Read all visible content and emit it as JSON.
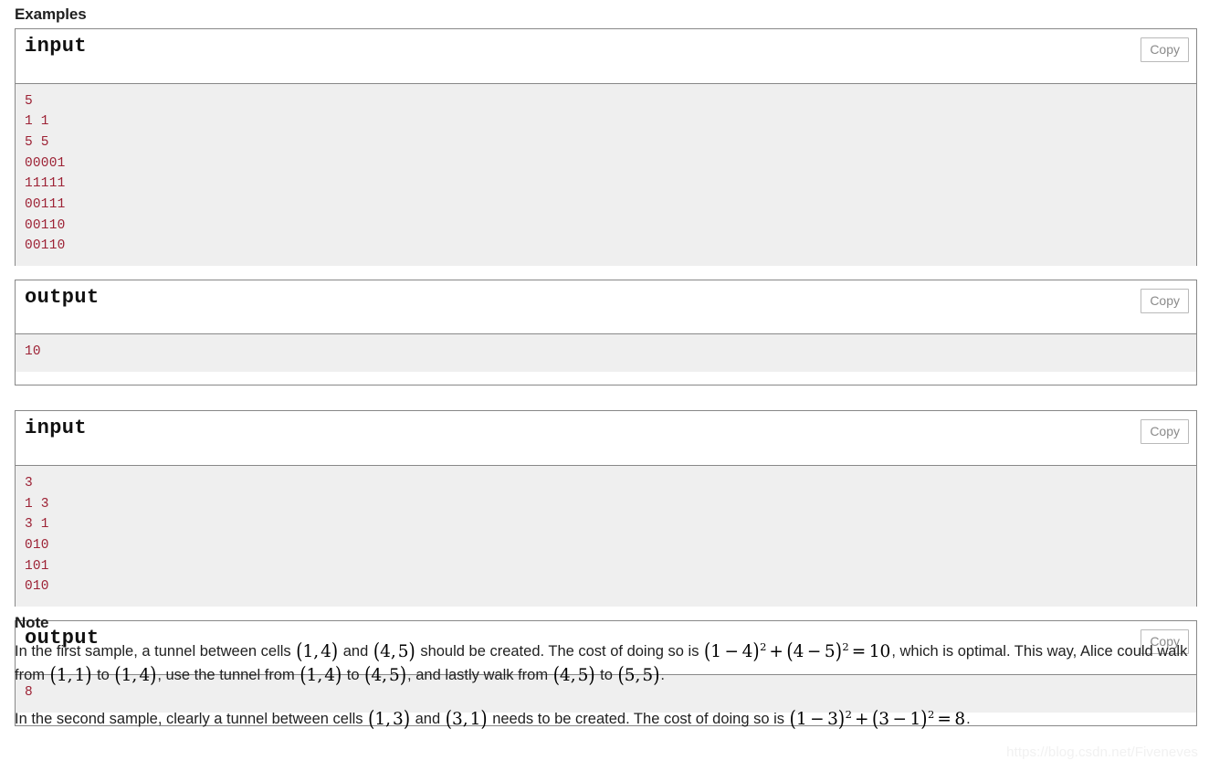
{
  "sections": {
    "examples_title": "Examples",
    "note_title": "Note"
  },
  "copy_label": "Copy",
  "samples": [
    {
      "input": {
        "title": "input",
        "text": "5\n1 1\n5 5\n00001\n11111\n00111\n00110\n00110"
      },
      "output": {
        "title": "output",
        "text": "10"
      }
    },
    {
      "input": {
        "title": "input",
        "text": "3\n1 3\n3 1\n010\n101\n010"
      },
      "output": {
        "title": "output",
        "text": "8"
      }
    }
  ],
  "note": {
    "paragraph1": {
      "t1": "In the first sample, a tunnel between cells ",
      "m1": "(1, 4)",
      "t2": " and ",
      "m2": "(4, 5)",
      "t3": " should be created. The cost of doing so is ",
      "m3": "(1 − 4)² + (4 − 5)² = 10",
      "t4": ", which is optimal. This way, Alice could walk from ",
      "m4": "(1, 1)",
      "t5": " to ",
      "m5": "(1, 4)",
      "t6": ", use the tunnel from ",
      "m6": "(1, 4)",
      "t7": " to ",
      "m7": "(4, 5)",
      "t8": ", and lastly walk from ",
      "m8": "(4, 5)",
      "t9": " to ",
      "m9": "(5, 5)",
      "t10": "."
    },
    "paragraph2": {
      "t1": "In the second sample, clearly a tunnel between cells ",
      "m1": "(1, 3)",
      "t2": " and ",
      "m2": "(3, 1)",
      "t3": " needs to be created. The cost of doing so is ",
      "m3": "(1 − 3)² + (3 − 1)² = 8",
      "t4": "."
    }
  },
  "watermark": "https://blog.csdn.net/Fiveneves",
  "colors": {
    "sample_text": "#9d2235",
    "block_bg": "#efefef",
    "border": "#888888",
    "copy_text": "#8a8a8a",
    "watermark": "#f1f1f1"
  }
}
